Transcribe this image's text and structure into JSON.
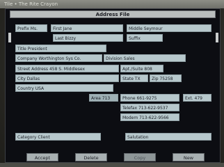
{
  "photo_caption": "Tile • The Rite Crayon",
  "window": {
    "title": "Address File"
  },
  "form": {
    "prefix": "Prefix Ms.",
    "first": "First Jane",
    "middle": "Middle Seymour",
    "last": "Last Bizzy",
    "suffix": "Suffix",
    "title": "Title President",
    "company": "Company Worthington Sys Co.",
    "division": "Division Sales",
    "street": "Street Address 458 S. Middlesex",
    "apt": "Apt./Suite 808",
    "city": "City Dallas",
    "state": "State TX",
    "zip": "Zip 75258",
    "country": "Country USA",
    "area": "Area 713",
    "phone": "Phone 661-9275",
    "ext": "Ext. 479",
    "telefax": "Telefax 713-622-9537",
    "modem": "Modem 713-622-9566",
    "category": "Category Client",
    "salutation": "Salutation"
  },
  "buttons": {
    "accept": "Accept",
    "delete": "Delete",
    "copy": "Copy",
    "new": "New"
  }
}
